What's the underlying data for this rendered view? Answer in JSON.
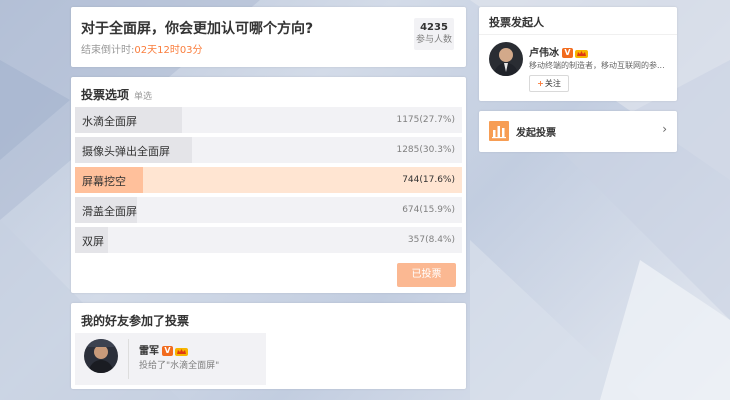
{
  "question": {
    "title": "对于全面屏，你会更加认可哪个方向?",
    "timer_prefix": "结束倒计时:",
    "timer_value": "02天12时03分",
    "participant_count": "4235",
    "participant_label": "参与人数"
  },
  "options_section": {
    "title": "投票选项",
    "mode": "单选",
    "items": [
      {
        "label": "水滴全面屏",
        "stat": "1175(27.7%)",
        "percent": 27.7,
        "selected": false
      },
      {
        "label": "摄像头弹出全面屏",
        "stat": "1285(30.3%)",
        "percent": 30.3,
        "selected": false
      },
      {
        "label": "屏幕挖空",
        "stat": "744(17.6%)",
        "percent": 17.6,
        "selected": true
      },
      {
        "label": "滑盖全面屏",
        "stat": "674(15.9%)",
        "percent": 15.9,
        "selected": false
      },
      {
        "label": "双屏",
        "stat": "357(8.4%)",
        "percent": 8.4,
        "selected": false
      }
    ],
    "voted_button": "已投票"
  },
  "friends_section": {
    "title": "我的好友参加了投票",
    "friend": {
      "name": "雷军",
      "action": "投给了\"水滴全面屏\""
    }
  },
  "initiator": {
    "title": "投票发起人",
    "name": "卢伟冰",
    "description": "移动终端的制造者，移动互联网的参...",
    "follow_label": "关注"
  },
  "start_vote": {
    "label": "发起投票",
    "chevron": "›"
  },
  "colors": {
    "accent": "#fa7d3c",
    "selected_bg": "#ffe5d2",
    "selected_fill": "#ffc09b",
    "voted_button": "#fbb892"
  }
}
